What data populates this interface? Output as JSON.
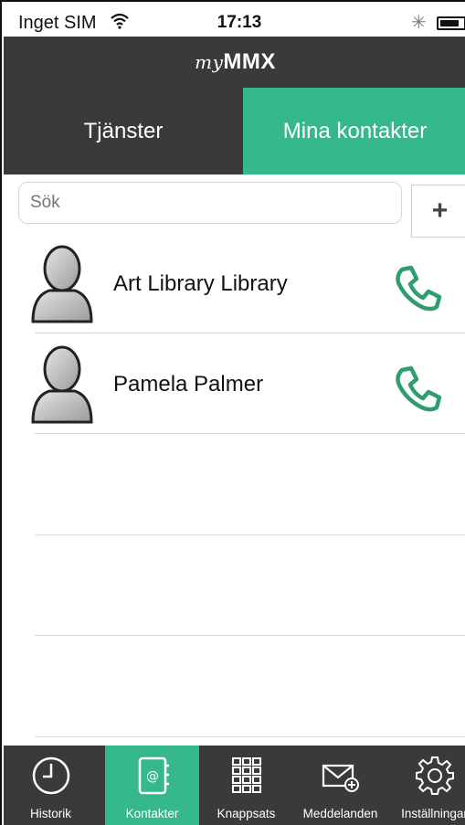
{
  "status_bar": {
    "carrier": "Inget SIM",
    "time": "17:13",
    "bluetooth_icon": "bluetooth-icon",
    "battery_icon": "battery-icon",
    "wifi_icon": "wifi-icon"
  },
  "header": {
    "logo_my": "my",
    "logo_brand": "MMX"
  },
  "segments": [
    {
      "label": "Tjänster",
      "selected": false
    },
    {
      "label": "Mina kontakter",
      "selected": true
    }
  ],
  "search": {
    "placeholder": "Sök",
    "value": "",
    "add_label": "+"
  },
  "contacts": [
    {
      "name": "Art Library Library",
      "avatar_icon": "person-avatar-icon",
      "action_icon": "phone-icon"
    },
    {
      "name": "Pamela Palmer",
      "avatar_icon": "person-avatar-icon",
      "action_icon": "phone-icon"
    }
  ],
  "tabbar": {
    "items": [
      {
        "label": "Historik",
        "icon": "clock-icon",
        "active": false
      },
      {
        "label": "Kontakter",
        "icon": "address-book-icon",
        "active": true
      },
      {
        "label": "Knappsats",
        "icon": "keypad-icon",
        "active": false
      },
      {
        "label": "Meddelanden",
        "icon": "envelope-icon",
        "active": false
      },
      {
        "label": "Inställningar",
        "icon": "gear-icon",
        "active": false
      }
    ]
  },
  "colors": {
    "accent": "#35b98c",
    "dark": "#3a3a3a",
    "phone_icon": "#2e9e6f"
  }
}
